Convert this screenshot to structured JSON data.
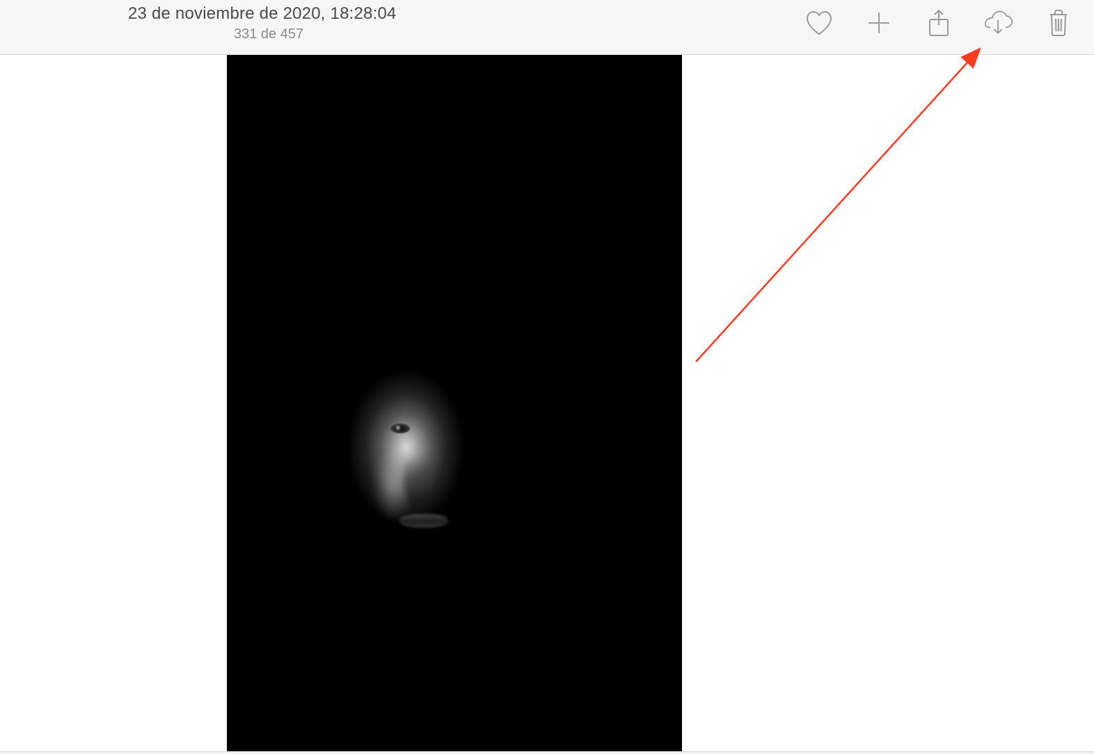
{
  "header": {
    "date_time": "23 de noviembre de 2020, 18:28:04",
    "counter": "331 de 457"
  },
  "toolbar": {
    "icons": {
      "favorite": "heart-icon",
      "add": "plus-icon",
      "share": "share-icon",
      "download": "cloud-download-icon",
      "delete": "trash-icon"
    }
  },
  "annotation": {
    "arrow_color": "#ff3b1f"
  }
}
